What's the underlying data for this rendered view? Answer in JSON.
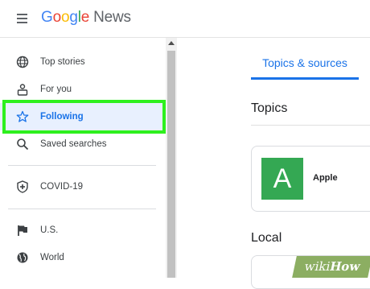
{
  "header": {
    "logo_google": [
      "G",
      "o",
      "o",
      "g",
      "l",
      "e"
    ],
    "logo_news": "News"
  },
  "sidebar": {
    "items": [
      {
        "label": "Top stories",
        "icon": "globe-icon"
      },
      {
        "label": "For you",
        "icon": "person-icon"
      },
      {
        "label": "Following",
        "icon": "star-icon",
        "active": true
      },
      {
        "label": "Saved searches",
        "icon": "search-icon"
      },
      {
        "label": "COVID-19",
        "icon": "shield-plus-icon"
      },
      {
        "label": "U.S.",
        "icon": "flag-icon"
      },
      {
        "label": "World",
        "icon": "globe-icon"
      }
    ]
  },
  "main": {
    "tab_label": "Topics & sources",
    "topics_title": "Topics",
    "topic_card": {
      "avatar_letter": "A",
      "name": "Apple"
    },
    "local_title": "Local"
  },
  "watermark": {
    "wiki": "wiki",
    "how": "How"
  },
  "colors": {
    "accent": "#1a73e8",
    "active_bg": "#e8f0fe",
    "highlight": "#2ef01e",
    "avatar": "#34a853"
  }
}
